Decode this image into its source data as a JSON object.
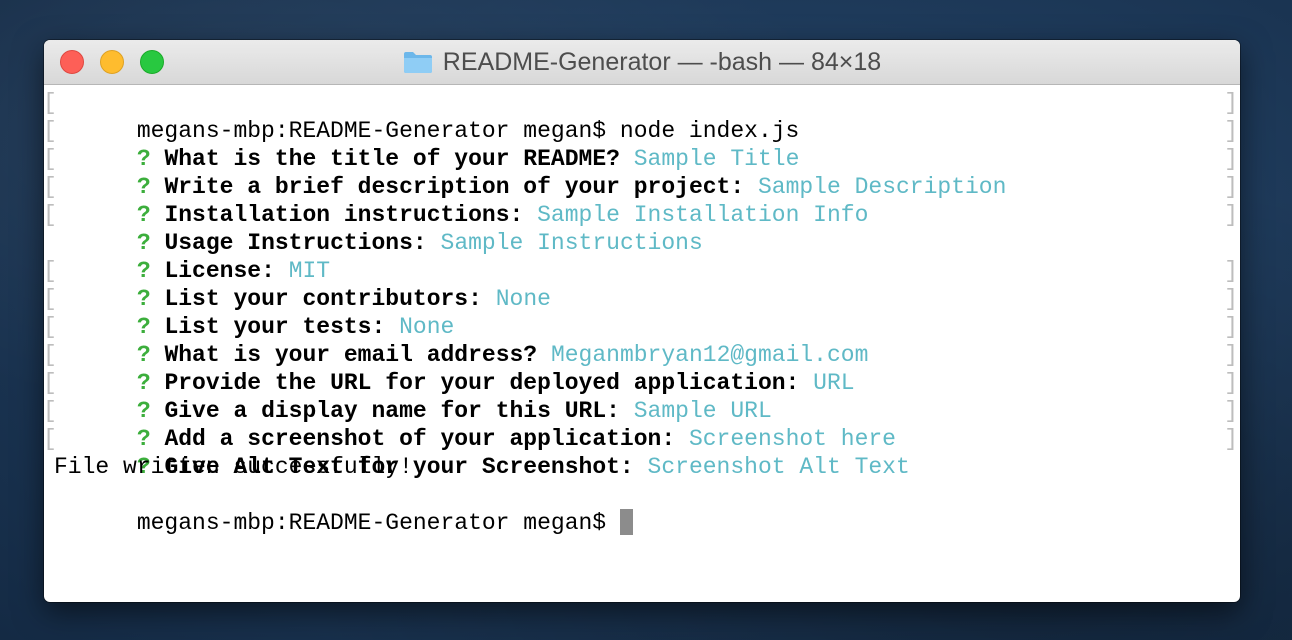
{
  "window": {
    "title": "README-Generator — -bash — 84×18",
    "folder_icon": "folder-icon"
  },
  "colors": {
    "question_mark": "#3cae3c",
    "answer": "#5fb9c6",
    "cursor": "#8c8c8c",
    "close": "#fd5f57",
    "minimize": "#febc2e",
    "zoom": "#28c840"
  },
  "terminal": {
    "command_prompt": "megans-mbp:README-Generator megan$ ",
    "command": "node index.js",
    "questions": [
      {
        "q": "?",
        "prompt": "What is the title of your README?",
        "answer": "Sample Title"
      },
      {
        "q": "?",
        "prompt": "Write a brief description of your project:",
        "answer": "Sample Description"
      },
      {
        "q": "?",
        "prompt": "Installation instructions:",
        "answer": "Sample Installation Info"
      },
      {
        "q": "?",
        "prompt": "Usage Instructions:",
        "answer": "Sample Instructions"
      },
      {
        "q": "?",
        "prompt": "License:",
        "answer": "MIT"
      },
      {
        "q": "?",
        "prompt": "List your contributors:",
        "answer": "None"
      },
      {
        "q": "?",
        "prompt": "List your tests:",
        "answer": "None"
      },
      {
        "q": "?",
        "prompt": "What is your email address?",
        "answer": "Meganmbryan12@gmail.com"
      },
      {
        "q": "?",
        "prompt": "Provide the URL for your deployed application:",
        "answer": "URL"
      },
      {
        "q": "?",
        "prompt": "Give a display name for this URL:",
        "answer": "Sample URL"
      },
      {
        "q": "?",
        "prompt": "Add a screenshot of your application:",
        "answer": "Screenshot here"
      },
      {
        "q": "?",
        "prompt": "Give Alt Text for your Screenshot:",
        "answer": "Screenshot Alt Text"
      }
    ],
    "success_message": "File written successfully!",
    "final_prompt": "megans-mbp:README-Generator megan$ "
  }
}
